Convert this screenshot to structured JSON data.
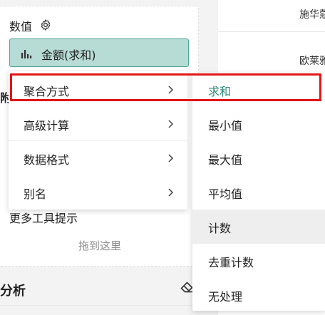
{
  "values_section": {
    "title": "数值",
    "field_pill": {
      "label": "金额(求和)",
      "icon": "bar-chart-icon"
    },
    "settings_icon": "gear-icon"
  },
  "partial_heading": "附",
  "tooltip_section": {
    "title": "更多工具提示",
    "drop_placeholder": "拖到这里"
  },
  "analysis_section": {
    "title": "分析",
    "clear_icon": "eraser-icon"
  },
  "right_panel": {
    "cells": [
      "施华蔻",
      "欧莱雅"
    ]
  },
  "context_menu": {
    "items": [
      {
        "label": "聚合方式",
        "has_submenu": true
      },
      {
        "label": "高级计算",
        "has_submenu": true
      },
      {
        "label": "数据格式",
        "has_submenu": true
      },
      {
        "label": "别名",
        "has_submenu": true
      }
    ]
  },
  "aggregation_submenu": {
    "selected": "求和",
    "hovered": "计数",
    "items": [
      {
        "label": "求和"
      },
      {
        "label": "最小值"
      },
      {
        "label": "最大值"
      },
      {
        "label": "平均值"
      },
      {
        "label": "计数"
      },
      {
        "label": "去重计数"
      },
      {
        "label": "无处理"
      }
    ]
  },
  "colors": {
    "accent": "#2b8a79",
    "pill_bg": "#b7dcd5",
    "pill_border": "#4aa596",
    "highlight": "#e31414"
  }
}
